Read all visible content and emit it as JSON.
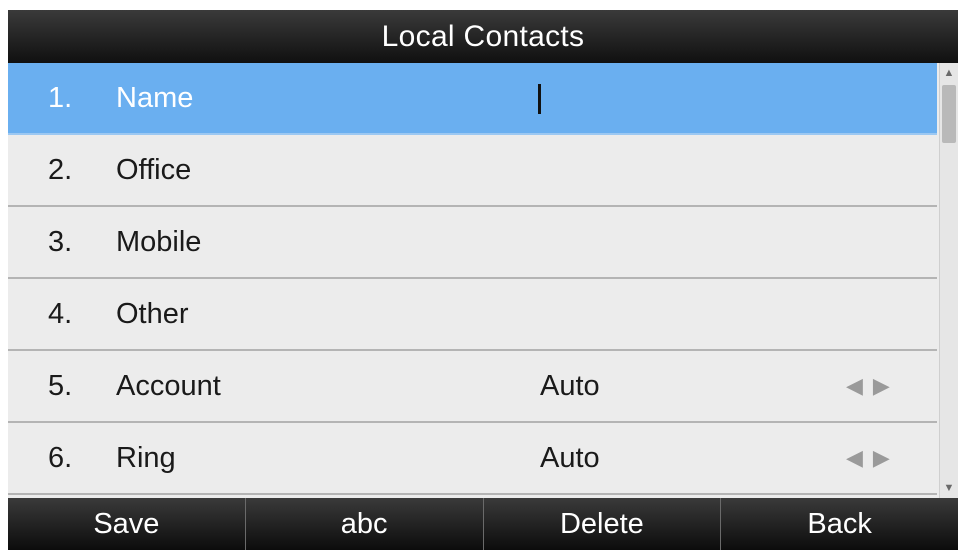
{
  "title": "Local Contacts",
  "rows": [
    {
      "num": "1.",
      "label": "Name",
      "value": "",
      "has_arrows": false,
      "selected": true
    },
    {
      "num": "2.",
      "label": "Office",
      "value": "",
      "has_arrows": false,
      "selected": false
    },
    {
      "num": "3.",
      "label": "Mobile",
      "value": "",
      "has_arrows": false,
      "selected": false
    },
    {
      "num": "4.",
      "label": "Other",
      "value": "",
      "has_arrows": false,
      "selected": false
    },
    {
      "num": "5.",
      "label": "Account",
      "value": "Auto",
      "has_arrows": true,
      "selected": false
    },
    {
      "num": "6.",
      "label": "Ring",
      "value": "Auto",
      "has_arrows": true,
      "selected": false
    }
  ],
  "arrows": {
    "left": "◀",
    "right": "▶"
  },
  "scroll": {
    "up": "▲",
    "down": "▼"
  },
  "softkeys": [
    "Save",
    "abc",
    "Delete",
    "Back"
  ],
  "colors": {
    "selected_row": "#6aaff0",
    "row_bg": "#ececec",
    "bar_bg": "#1a1a1a"
  }
}
